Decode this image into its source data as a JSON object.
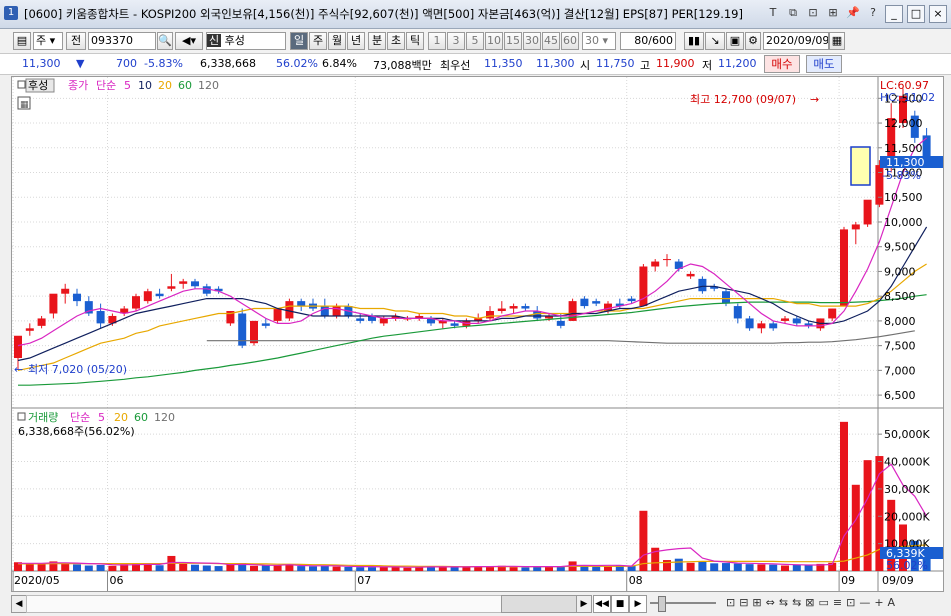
{
  "window": {
    "number": "1",
    "title": "[0600] 키움종합차트 - KOSPI200 외국인보유[4,156(천)] 주식수[92,607(천)] 액면[500] 자본금[463(억)] 결산[12월] EPS[87] PER[129.19]",
    "tool_icons": [
      "T",
      "⧉",
      "⊡",
      "⊞",
      "📌",
      "?"
    ],
    "controls": [
      "_",
      "□",
      "×"
    ]
  },
  "toolbar": {
    "type_label": "주",
    "prev_label": "전",
    "code": "093370",
    "sin_label": "신",
    "stock_name": "후성",
    "periods": [
      "일",
      "주",
      "월",
      "년",
      "분",
      "초",
      "틱"
    ],
    "selected_period": "일",
    "intervals": [
      "1",
      "3",
      "5",
      "10",
      "15",
      "30",
      "45",
      "60"
    ],
    "interval_value": "30",
    "count": "80/600",
    "date": "2020/09/09"
  },
  "quote": {
    "price": "11,300",
    "change": "700",
    "change_pct": "-5.83%",
    "volume": "6,338,668",
    "volume_ratio": "56.02%",
    "turnover": "6.84%",
    "amount": "73,088백만",
    "best_bid_label": "최우선",
    "best_ask": "11,350",
    "best_bid": "11,300",
    "open_label": "시",
    "open": "11,750",
    "high_label": "고",
    "high": "11,900",
    "low_label": "저",
    "low": "11,200",
    "buy_label": "매수",
    "sell_label": "매도"
  },
  "price_panel": {
    "stock_tag": "후성",
    "legend": {
      "close": "종가",
      "method": "단순",
      "periods": [
        "5",
        "10",
        "20",
        "60",
        "120"
      ]
    },
    "lc_label": "LC:60.97",
    "hc_label": "HC:-11.02",
    "high_annotation": "최고 12,700 (09/07)",
    "low_annotation": "최저 7,020 (05/20)",
    "y_ticks": [
      "12,500",
      "12,000",
      "11,500",
      "11,000",
      "10,500",
      "10,000",
      "9,500",
      "9,000",
      "8,500",
      "8,000",
      "7,500",
      "7,000",
      "6,500"
    ],
    "current_tag": "11,300",
    "current_change": "-5.83%"
  },
  "volume_panel": {
    "legend": {
      "name": "거래량",
      "method": "단순",
      "periods": [
        "5",
        "20",
        "60",
        "120"
      ]
    },
    "current_text": "6,338,668주(56.02%)",
    "y_ticks": [
      "50,000K",
      "40,000K",
      "30,000K",
      "20,000K",
      "10,000K"
    ],
    "current_tag": "6,339K",
    "current_pct": "56.02%"
  },
  "x_axis": {
    "labels": [
      "2020/05",
      "06",
      "07",
      "08",
      "09"
    ],
    "right_label": "09/09"
  },
  "colors": {
    "up": "#e8141b",
    "down": "#1a5fd1",
    "ma5": "#d926c2",
    "ma10": "#10205e",
    "ma20": "#e8a800",
    "ma60": "#1a9a3a",
    "ma120": "#707070"
  },
  "chart_data": {
    "type": "candlestick",
    "ylim": [
      6300,
      12850
    ],
    "candles": [
      {
        "o": 7250,
        "h": 7350,
        "l": 7020,
        "c": 7700
      },
      {
        "o": 7800,
        "h": 7950,
        "l": 7700,
        "c": 7850
      },
      {
        "o": 7900,
        "h": 8100,
        "l": 7850,
        "c": 8050
      },
      {
        "o": 8150,
        "h": 8350,
        "l": 8050,
        "c": 8550
      },
      {
        "o": 8550,
        "h": 8750,
        "l": 8350,
        "c": 8650
      },
      {
        "o": 8550,
        "h": 8650,
        "l": 8300,
        "c": 8400
      },
      {
        "o": 8400,
        "h": 8500,
        "l": 8100,
        "c": 8150
      },
      {
        "o": 8200,
        "h": 8350,
        "l": 7850,
        "c": 7950
      },
      {
        "o": 7950,
        "h": 8150,
        "l": 7900,
        "c": 8100
      },
      {
        "o": 8150,
        "h": 8300,
        "l": 8100,
        "c": 8250
      },
      {
        "o": 8250,
        "h": 8550,
        "l": 8200,
        "c": 8500
      },
      {
        "o": 8400,
        "h": 8650,
        "l": 8350,
        "c": 8600
      },
      {
        "o": 8550,
        "h": 8650,
        "l": 8450,
        "c": 8500
      },
      {
        "o": 8650,
        "h": 8950,
        "l": 8600,
        "c": 8700
      },
      {
        "o": 8750,
        "h": 8850,
        "l": 8650,
        "c": 8800
      },
      {
        "o": 8800,
        "h": 8850,
        "l": 8650,
        "c": 8700
      },
      {
        "o": 8700,
        "h": 8750,
        "l": 8500,
        "c": 8550
      },
      {
        "o": 8650,
        "h": 8700,
        "l": 8550,
        "c": 8600
      },
      {
        "o": 7950,
        "h": 8200,
        "l": 7900,
        "c": 8200
      },
      {
        "o": 8150,
        "h": 8250,
        "l": 7450,
        "c": 7500
      },
      {
        "o": 7550,
        "h": 8000,
        "l": 7500,
        "c": 8000
      },
      {
        "o": 7950,
        "h": 8050,
        "l": 7850,
        "c": 7900
      },
      {
        "o": 8000,
        "h": 8250,
        "l": 7950,
        "c": 8250
      },
      {
        "o": 8050,
        "h": 8450,
        "l": 8000,
        "c": 8400
      },
      {
        "o": 8400,
        "h": 8450,
        "l": 8200,
        "c": 8300
      },
      {
        "o": 8350,
        "h": 8450,
        "l": 8200,
        "c": 8250
      },
      {
        "o": 8300,
        "h": 8450,
        "l": 8050,
        "c": 8100
      },
      {
        "o": 8100,
        "h": 8350,
        "l": 8050,
        "c": 8300
      },
      {
        "o": 8300,
        "h": 8350,
        "l": 8050,
        "c": 8100
      },
      {
        "o": 8050,
        "h": 8150,
        "l": 7950,
        "c": 8000
      },
      {
        "o": 8100,
        "h": 8150,
        "l": 7950,
        "c": 8000
      },
      {
        "o": 7950,
        "h": 8100,
        "l": 7900,
        "c": 8050
      },
      {
        "o": 8050,
        "h": 8150,
        "l": 8000,
        "c": 8100
      },
      {
        "o": 8050,
        "h": 8100,
        "l": 8000,
        "c": 8050
      },
      {
        "o": 8050,
        "h": 8150,
        "l": 8000,
        "c": 8100
      },
      {
        "o": 8050,
        "h": 8100,
        "l": 7900,
        "c": 7950
      },
      {
        "o": 7950,
        "h": 8050,
        "l": 7850,
        "c": 8000
      },
      {
        "o": 7950,
        "h": 8000,
        "l": 7850,
        "c": 7900
      },
      {
        "o": 7900,
        "h": 8050,
        "l": 7850,
        "c": 8000
      },
      {
        "o": 8000,
        "h": 8150,
        "l": 7950,
        "c": 8050
      },
      {
        "o": 8050,
        "h": 8300,
        "l": 8000,
        "c": 8200
      },
      {
        "o": 8200,
        "h": 8400,
        "l": 8150,
        "c": 8250
      },
      {
        "o": 8250,
        "h": 8350,
        "l": 8150,
        "c": 8300
      },
      {
        "o": 8300,
        "h": 8350,
        "l": 8200,
        "c": 8250
      },
      {
        "o": 8200,
        "h": 8300,
        "l": 8000,
        "c": 8050
      },
      {
        "o": 8050,
        "h": 8150,
        "l": 8000,
        "c": 8100
      },
      {
        "o": 8000,
        "h": 8150,
        "l": 7850,
        "c": 7900
      },
      {
        "o": 8000,
        "h": 8450,
        "l": 8000,
        "c": 8400
      },
      {
        "o": 8450,
        "h": 8500,
        "l": 8250,
        "c": 8300
      },
      {
        "o": 8400,
        "h": 8450,
        "l": 8300,
        "c": 8350
      },
      {
        "o": 8200,
        "h": 8400,
        "l": 8150,
        "c": 8350
      },
      {
        "o": 8350,
        "h": 8450,
        "l": 8250,
        "c": 8300
      },
      {
        "o": 8450,
        "h": 8500,
        "l": 8350,
        "c": 8400
      },
      {
        "o": 8300,
        "h": 9150,
        "l": 8300,
        "c": 9100
      },
      {
        "o": 9100,
        "h": 9250,
        "l": 9000,
        "c": 9200
      },
      {
        "o": 9250,
        "h": 9350,
        "l": 9100,
        "c": 9250
      },
      {
        "o": 9200,
        "h": 9250,
        "l": 9000,
        "c": 9050
      },
      {
        "o": 8900,
        "h": 9000,
        "l": 8850,
        "c": 8950
      },
      {
        "o": 8850,
        "h": 8900,
        "l": 8550,
        "c": 8600
      },
      {
        "o": 8700,
        "h": 8750,
        "l": 8600,
        "c": 8650
      },
      {
        "o": 8600,
        "h": 8650,
        "l": 8300,
        "c": 8350
      },
      {
        "o": 8300,
        "h": 8350,
        "l": 7950,
        "c": 8050
      },
      {
        "o": 8050,
        "h": 8100,
        "l": 7800,
        "c": 7850
      },
      {
        "o": 7850,
        "h": 8000,
        "l": 7750,
        "c": 7950
      },
      {
        "o": 7950,
        "h": 8000,
        "l": 7800,
        "c": 7850
      },
      {
        "o": 8000,
        "h": 8100,
        "l": 7950,
        "c": 8050
      },
      {
        "o": 8050,
        "h": 8100,
        "l": 7900,
        "c": 7950
      },
      {
        "o": 7950,
        "h": 8000,
        "l": 7850,
        "c": 7900
      },
      {
        "o": 7850,
        "h": 8050,
        "l": 7800,
        "c": 8050
      },
      {
        "o": 8050,
        "h": 8250,
        "l": 8000,
        "c": 8250
      },
      {
        "o": 8300,
        "h": 9900,
        "l": 8300,
        "c": 9850
      },
      {
        "o": 9850,
        "h": 10000,
        "l": 9550,
        "c": 9950
      },
      {
        "o": 9950,
        "h": 10400,
        "l": 9900,
        "c": 10450
      },
      {
        "o": 10350,
        "h": 11250,
        "l": 10300,
        "c": 11150
      },
      {
        "o": 11200,
        "h": 12400,
        "l": 11000,
        "c": 12100
      },
      {
        "o": 12000,
        "h": 12700,
        "l": 11900,
        "c": 12550
      },
      {
        "o": 12150,
        "h": 12250,
        "l": 11600,
        "c": 11700
      },
      {
        "o": 11750,
        "h": 11900,
        "l": 11200,
        "c": 11300
      }
    ],
    "ma5": [
      7500,
      7550,
      7650,
      7800,
      7950,
      8100,
      8200,
      8250,
      8200,
      8150,
      8200,
      8300,
      8400,
      8500,
      8600,
      8650,
      8650,
      8600,
      8500,
      8350,
      8200,
      8050,
      7950,
      7950,
      8000,
      8150,
      8250,
      8250,
      8200,
      8150,
      8100,
      8050,
      8050,
      8050,
      8050,
      8050,
      8000,
      8000,
      7950,
      7950,
      8000,
      8100,
      8150,
      8200,
      8200,
      8150,
      8100,
      8100,
      8150,
      8200,
      8250,
      8300,
      8350,
      8450,
      8600,
      8800,
      9050,
      9150,
      9100,
      8950,
      8750,
      8550,
      8350,
      8150,
      8000,
      7950,
      7900,
      7900,
      7900,
      7950,
      8200,
      8600,
      9050,
      9600,
      10300,
      11000,
      11500,
      11700
    ],
    "ma10": [
      7200,
      7250,
      7350,
      7450,
      7550,
      7650,
      7750,
      7850,
      7950,
      8050,
      8150,
      8200,
      8250,
      8300,
      8350,
      8400,
      8450,
      8450,
      8450,
      8450,
      8400,
      8350,
      8250,
      8200,
      8150,
      8100,
      8100,
      8100,
      8100,
      8100,
      8100,
      8100,
      8100,
      8050,
      8050,
      8050,
      8050,
      8000,
      8000,
      8000,
      8000,
      8050,
      8050,
      8100,
      8100,
      8100,
      8100,
      8150,
      8150,
      8150,
      8200,
      8250,
      8250,
      8300,
      8400,
      8500,
      8600,
      8650,
      8700,
      8700,
      8650,
      8600,
      8550,
      8450,
      8350,
      8200,
      8100,
      8000,
      7950,
      7950,
      8000,
      8100,
      8200,
      8400,
      8700,
      9100,
      9500,
      9900
    ],
    "ma20": [
      7000,
      7050,
      7100,
      7150,
      7250,
      7350,
      7450,
      7550,
      7600,
      7650,
      7750,
      7800,
      7900,
      7950,
      8000,
      8050,
      8100,
      8150,
      8150,
      8200,
      8250,
      8250,
      8250,
      8300,
      8300,
      8300,
      8300,
      8300,
      8300,
      8250,
      8250,
      8250,
      8200,
      8200,
      8150,
      8150,
      8150,
      8100,
      8100,
      8050,
      8100,
      8100,
      8100,
      8100,
      8150,
      8150,
      8150,
      8150,
      8150,
      8200,
      8200,
      8200,
      8250,
      8250,
      8300,
      8350,
      8400,
      8450,
      8450,
      8450,
      8450,
      8450,
      8450,
      8450,
      8450,
      8400,
      8350,
      8350,
      8300,
      8300,
      8300,
      8300,
      8350,
      8450,
      8600,
      8800,
      9000,
      9150
    ],
    "ma60": [
      6700,
      6700,
      6710,
      6720,
      6730,
      6740,
      6760,
      6780,
      6800,
      6820,
      6850,
      6870,
      6900,
      6930,
      6960,
      7000,
      7030,
      7060,
      7100,
      7130,
      7170,
      7210,
      7250,
      7300,
      7350,
      7400,
      7450,
      7500,
      7550,
      7600,
      7650,
      7690,
      7720,
      7750,
      7780,
      7810,
      7840,
      7870,
      7890,
      7910,
      7930,
      7950,
      7970,
      7990,
      8010,
      8030,
      8050,
      8070,
      8090,
      8110,
      8130,
      8150,
      8170,
      8200,
      8230,
      8260,
      8290,
      8310,
      8330,
      8350,
      8360,
      8370,
      8380,
      8380,
      8380,
      8380,
      8380,
      8380,
      8370,
      8370,
      8370,
      8380,
      8390,
      8410,
      8430,
      8460,
      8500,
      8530
    ],
    "ma120_start_index": 16,
    "ma120": [
      7600,
      7600,
      7600,
      7600,
      7600,
      7600,
      7600,
      7600,
      7600,
      7600,
      7600,
      7600,
      7600,
      7600,
      7600,
      7600,
      7600,
      7600,
      7600,
      7600,
      7600,
      7600,
      7600,
      7600,
      7600,
      7600,
      7600,
      7600,
      7600,
      7600,
      7600,
      7600,
      7600,
      7600,
      7600,
      7590,
      7580,
      7570,
      7560,
      7550,
      7550,
      7550,
      7550,
      7550,
      7550,
      7550,
      7550,
      7550,
      7550,
      7560,
      7560,
      7570,
      7570,
      7580,
      7600,
      7620,
      7650,
      7680,
      7720,
      7760,
      7800
    ],
    "volume": [
      3200,
      2800,
      2600,
      3500,
      3100,
      2400,
      2000,
      2200,
      1900,
      2500,
      2800,
      2600,
      2100,
      5500,
      2600,
      2300,
      2000,
      1800,
      2800,
      2900,
      1900,
      2100,
      2000,
      2500,
      1800,
      1700,
      2000,
      1600,
      1500,
      1400,
      1400,
      1600,
      1500,
      1200,
      1300,
      1800,
      1600,
      1400,
      1500,
      1700,
      1800,
      1900,
      1400,
      1300,
      1700,
      1600,
      1800,
      3500,
      1800,
      1600,
      1600,
      2100,
      1800,
      22000,
      8500,
      4000,
      4500,
      3000,
      3500,
      2800,
      2900,
      2700,
      2500,
      2400,
      2300,
      2000,
      2200,
      2100,
      2600,
      3000,
      54500,
      31500,
      40500,
      42000,
      26000,
      17000,
      11000,
      6300
    ],
    "vol_ma5": [
      2800,
      2800,
      2800,
      3000,
      3000,
      2900,
      2700,
      2600,
      2300,
      2200,
      2300,
      2400,
      2400,
      3100,
      3100,
      3000,
      2900,
      2800,
      2300,
      2400,
      2300,
      2100,
      2100,
      2300,
      2000,
      1900,
      1900,
      1900,
      1700,
      1600,
      1600,
      1500,
      1500,
      1400,
      1400,
      1500,
      1500,
      1500,
      1500,
      1600,
      1600,
      1700,
      1700,
      1600,
      1600,
      1600,
      1600,
      2000,
      2100,
      2000,
      2100,
      2100,
      1800,
      5800,
      7100,
      7700,
      8200,
      8400,
      4700,
      3600,
      3300,
      2900,
      2800,
      2700,
      2600,
      2400,
      2300,
      2200,
      2200,
      2400,
      12800,
      18700,
      26500,
      35500,
      39000,
      31400,
      27300,
      20000
    ],
    "vol_ma20": [
      2600,
      2600,
      2600,
      2700,
      2700,
      2700,
      2700,
      2700,
      2700,
      2700,
      2700,
      2700,
      2700,
      2800,
      2800,
      2800,
      2800,
      2700,
      2700,
      2700,
      2600,
      2600,
      2500,
      2500,
      2400,
      2300,
      2300,
      2200,
      2100,
      2000,
      2000,
      1900,
      1800,
      1800,
      1700,
      1700,
      1700,
      1600,
      1600,
      1600,
      1600,
      1600,
      1600,
      1600,
      1600,
      1600,
      1600,
      1700,
      1700,
      1700,
      1700,
      1700,
      1700,
      2700,
      3000,
      3100,
      3300,
      3400,
      3500,
      3500,
      3500,
      3500,
      3500,
      3500,
      3500,
      3400,
      3400,
      3400,
      3400,
      3400,
      3600,
      4700,
      5900,
      7900,
      8300,
      8900,
      9300,
      9500
    ],
    "vol_ylim": [
      0,
      57000
    ],
    "x_labels": [
      {
        "label": "2020/05",
        "index": 0
      },
      {
        "label": "06",
        "index": 8
      },
      {
        "label": "07",
        "index": 29
      },
      {
        "label": "08",
        "index": 52
      },
      {
        "label": "09",
        "index": 70
      }
    ]
  }
}
